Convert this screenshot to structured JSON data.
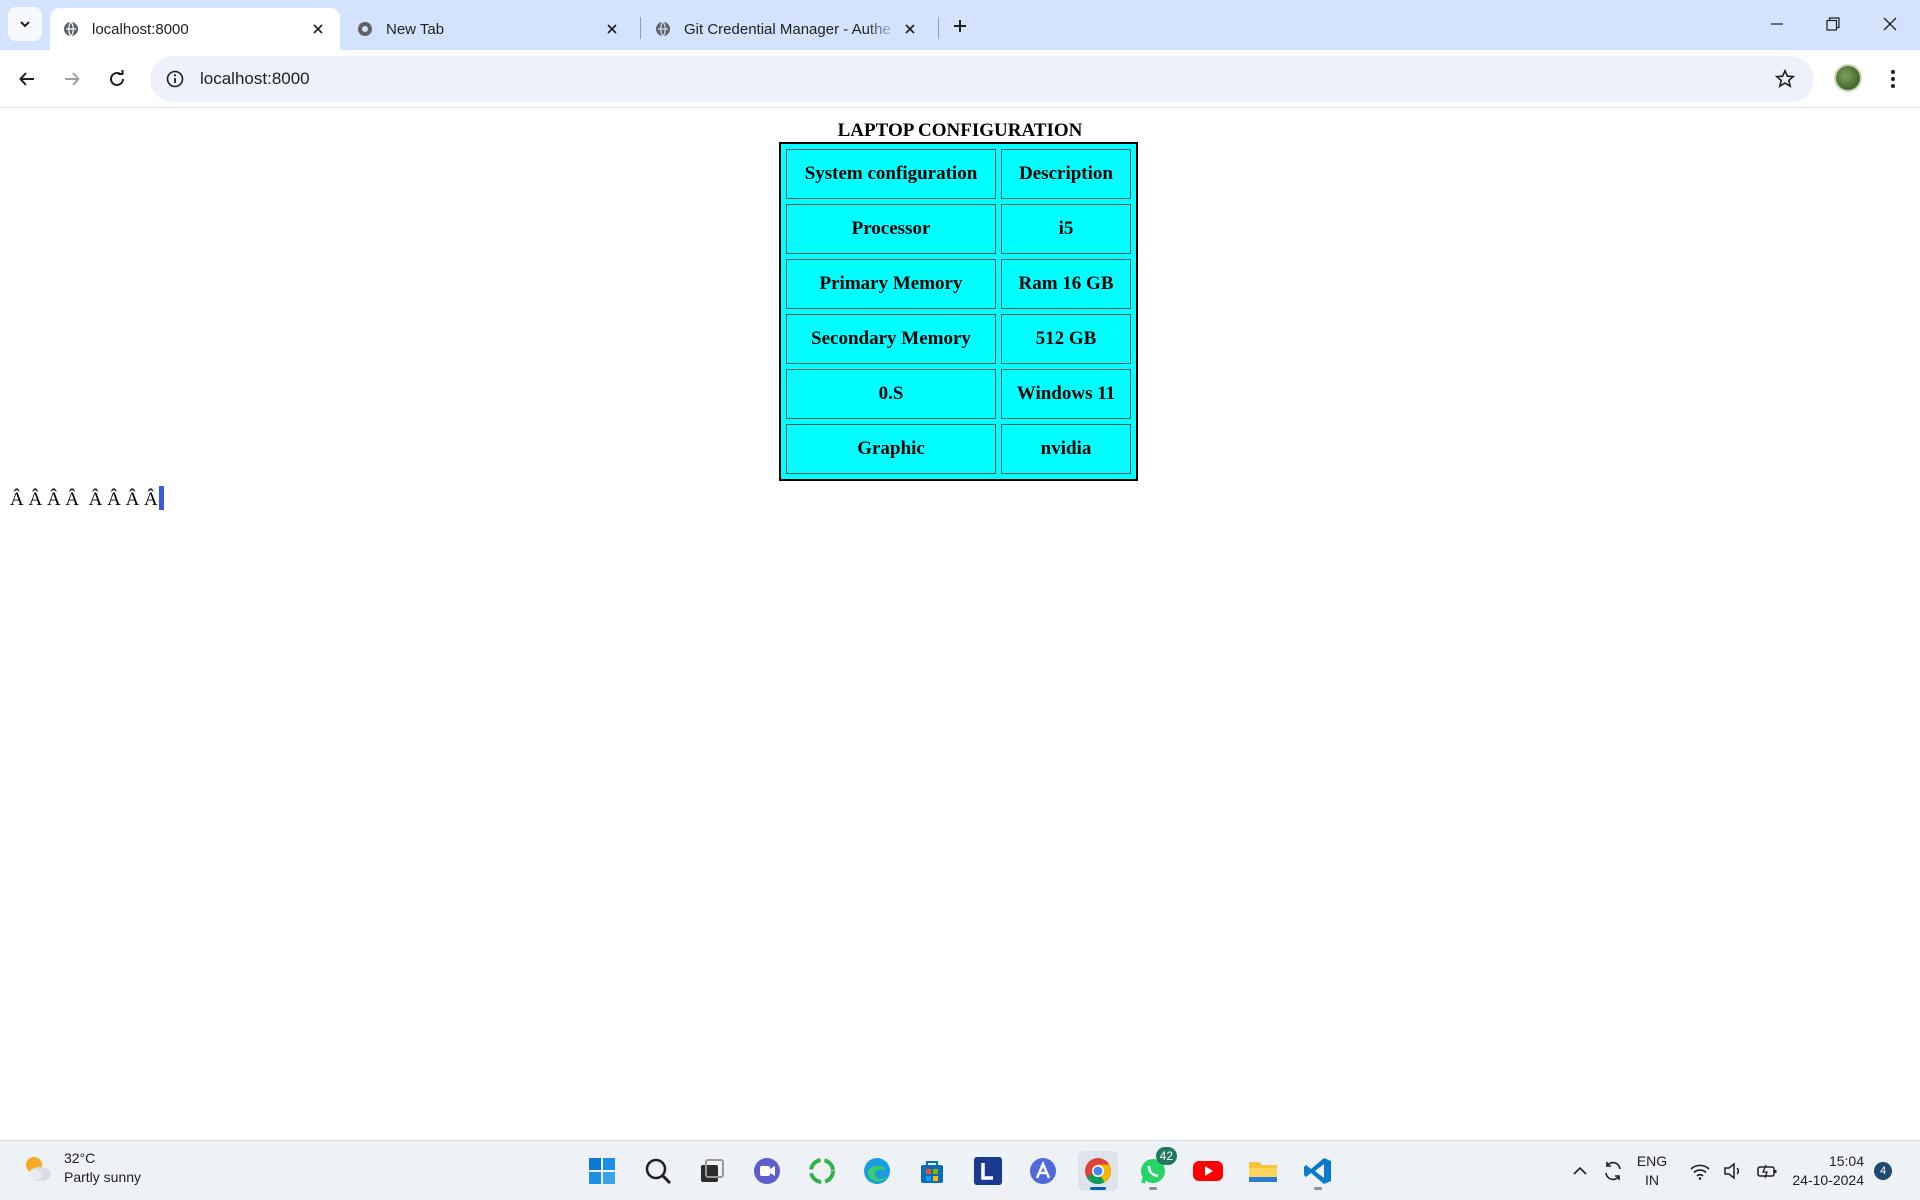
{
  "browser": {
    "tabs": [
      {
        "title": "localhost:8000",
        "active": true
      },
      {
        "title": "New Tab",
        "active": false
      },
      {
        "title": "Git Credential Manager - Authe",
        "active": false
      }
    ],
    "address": "localhost:8000"
  },
  "page": {
    "heading": "LAPTOP CONFIGURATION",
    "table": {
      "header": [
        "System configuration",
        "Description"
      ],
      "rows": [
        [
          "Processor",
          "i5"
        ],
        [
          "Primary Memory",
          "Ram 16 GB"
        ],
        [
          "Secondary Memory",
          "512 GB"
        ],
        [
          "0.S",
          "Windows 11"
        ],
        [
          "Graphic",
          "nvidia"
        ]
      ],
      "background_color": "#00ffff"
    },
    "stray_text": "Â Â Â Â  Â Â Â Â"
  },
  "taskbar": {
    "weather": {
      "temperature": "32°C",
      "condition": "Partly sunny"
    },
    "apps": [
      "start-icon",
      "search-icon",
      "task-view-icon",
      "teams-meet-icon",
      "sync-circle-icon",
      "edge-icon",
      "store-icon",
      "l-app-icon",
      "arc-icon",
      "chrome-icon",
      "whatsapp-icon",
      "youtube-icon",
      "file-explorer-icon",
      "vscode-icon"
    ],
    "whatsapp_badge": "42",
    "language": {
      "line1": "ENG",
      "line2": "IN"
    },
    "clock": {
      "time": "15:04",
      "date": "24-10-2024"
    },
    "notification_count": "4"
  }
}
